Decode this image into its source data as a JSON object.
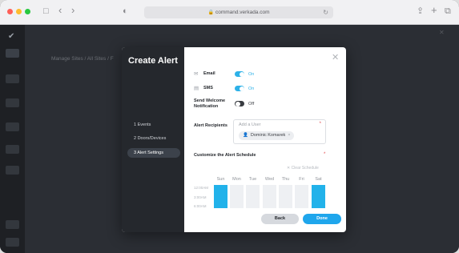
{
  "browser": {
    "url": "command.verkada.com",
    "lock_icon": "🔒",
    "reload_icon": "↻",
    "sidebar_icon": "□",
    "back_icon": "‹",
    "forward_icon": "›",
    "privacy_icon": "◐",
    "share_icon": "⇪",
    "new_tab_icon": "+",
    "tabs_icon": "⧉"
  },
  "background": {
    "logo_icon": "✔",
    "breadcrumb": "Manage Sites  /  All Sites  /  F",
    "close_icon": "✕"
  },
  "modal": {
    "title": "Create Alert",
    "close_icon": "✕",
    "steps": [
      {
        "label": "1  Events"
      },
      {
        "label": "2  Doors/Devices"
      },
      {
        "label": "3  Alert Settings"
      }
    ],
    "channels": {
      "email": {
        "icon": "✉",
        "label": "Email",
        "state": "On"
      },
      "sms": {
        "icon": "▤",
        "label": "SMS",
        "state": "On"
      },
      "welcome": {
        "label": "Send Welcome Notification",
        "state": "Off"
      }
    },
    "recipients": {
      "label": "Alert Recipients",
      "placeholder": "Add a User",
      "required": "*",
      "chip_icon": "👤",
      "chip_name": "Dominic Komarek",
      "chip_remove": "×"
    },
    "schedule": {
      "label": "Customize the Alert Schedule",
      "required": "*",
      "clear_label": "✕  Clear Schedule",
      "days": [
        "Sun",
        "Mon",
        "Tue",
        "Wed",
        "Thu",
        "Fri",
        "Sat"
      ],
      "selected_days": [
        "Sun",
        "Sat"
      ],
      "times": [
        "12:00AM",
        "3:00AM",
        "6:00AM"
      ]
    },
    "buttons": {
      "back": "Back",
      "done": "Done"
    }
  },
  "colors": {
    "accent": "#22b2ea",
    "dark_panel": "#25282d",
    "background": "#2b2e34"
  }
}
